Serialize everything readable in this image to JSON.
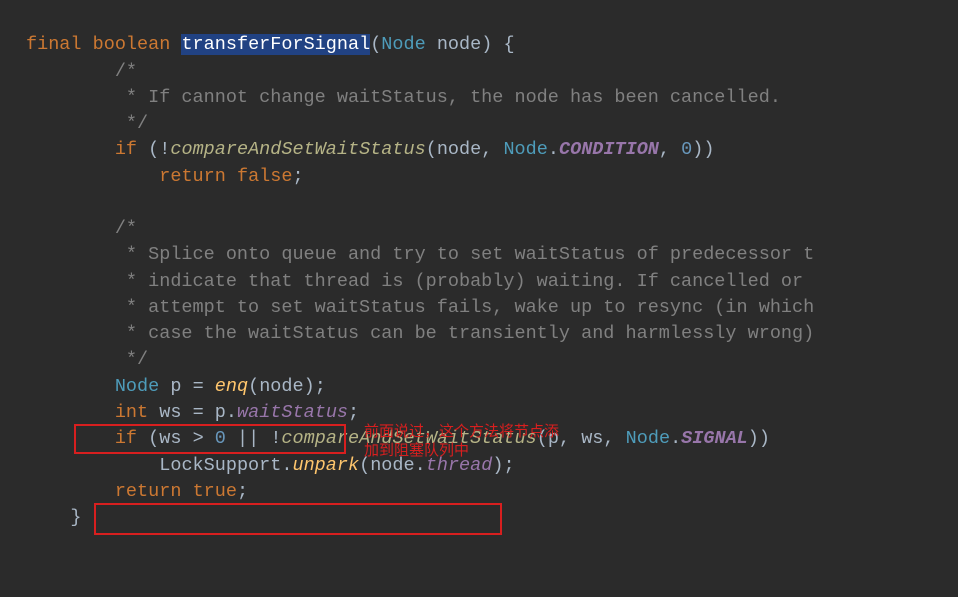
{
  "code": {
    "l1": {
      "final": "final",
      "boolean": "boolean",
      "fn": "transferForSignal",
      "lp": "(",
      "type": "Node",
      "param": "node",
      "rp": ") {"
    },
    "l2": "        /*",
    "l3": "         * If cannot change waitStatus, the node has been cancelled.",
    "l4": "         */",
    "l5": {
      "if": "if",
      "open": " (!",
      "call": "compareAndSetWaitStatus",
      "args_open": "(",
      "a1": "node",
      "c1": ", ",
      "node": "Node",
      "dot": ".",
      "cond": "CONDITION",
      "c2": ", ",
      "zero": "0",
      "close": "))"
    },
    "l6": {
      "ret": "return",
      "val": "false",
      "semi": ";"
    },
    "l8": "        /*",
    "l9": "         * Splice onto queue and try to set waitStatus of predecessor t",
    "l10": "         * indicate that thread is (probably) waiting. If cancelled or ",
    "l11": "         * attempt to set waitStatus fails, wake up to resync (in which",
    "l12": "         * case the waitStatus can be transiently and harmlessly wrong)",
    "l13": "         */",
    "l14": {
      "type": "Node",
      "p": "p",
      "eq": " = ",
      "enq": "enq",
      "open": "(",
      "node": "node",
      "close": ");"
    },
    "l15": {
      "int": "int",
      "ws": "ws",
      "eq": " = ",
      "p": "p",
      "dot": ".",
      "fld": "waitStatus",
      "semi": ";"
    },
    "l16": {
      "if": "if",
      "open": " (",
      "ws": "ws",
      "gt": " > ",
      "zero": "0",
      "or": " || !",
      "call": "compareAndSetWaitStatus",
      "ao": "(",
      "p": "p",
      "c1": ", ",
      "ws2": "ws",
      "c2": ", ",
      "node": "Node",
      "dot": ".",
      "sig": "SIGNAL",
      "ac": "))"
    },
    "l17": {
      "ls": "LockSupport",
      "dot": ".",
      "unpark": "unpark",
      "open": "(",
      "node": "node",
      "dot2": ".",
      "thread": "thread",
      "close": ");"
    },
    "l18": {
      "ret": "return",
      "val": "true",
      "semi": ";"
    },
    "l19": "    }"
  },
  "annotation": {
    "line1": "前面说过，这个方法将节点添",
    "line2": "加到阻塞队列中"
  }
}
